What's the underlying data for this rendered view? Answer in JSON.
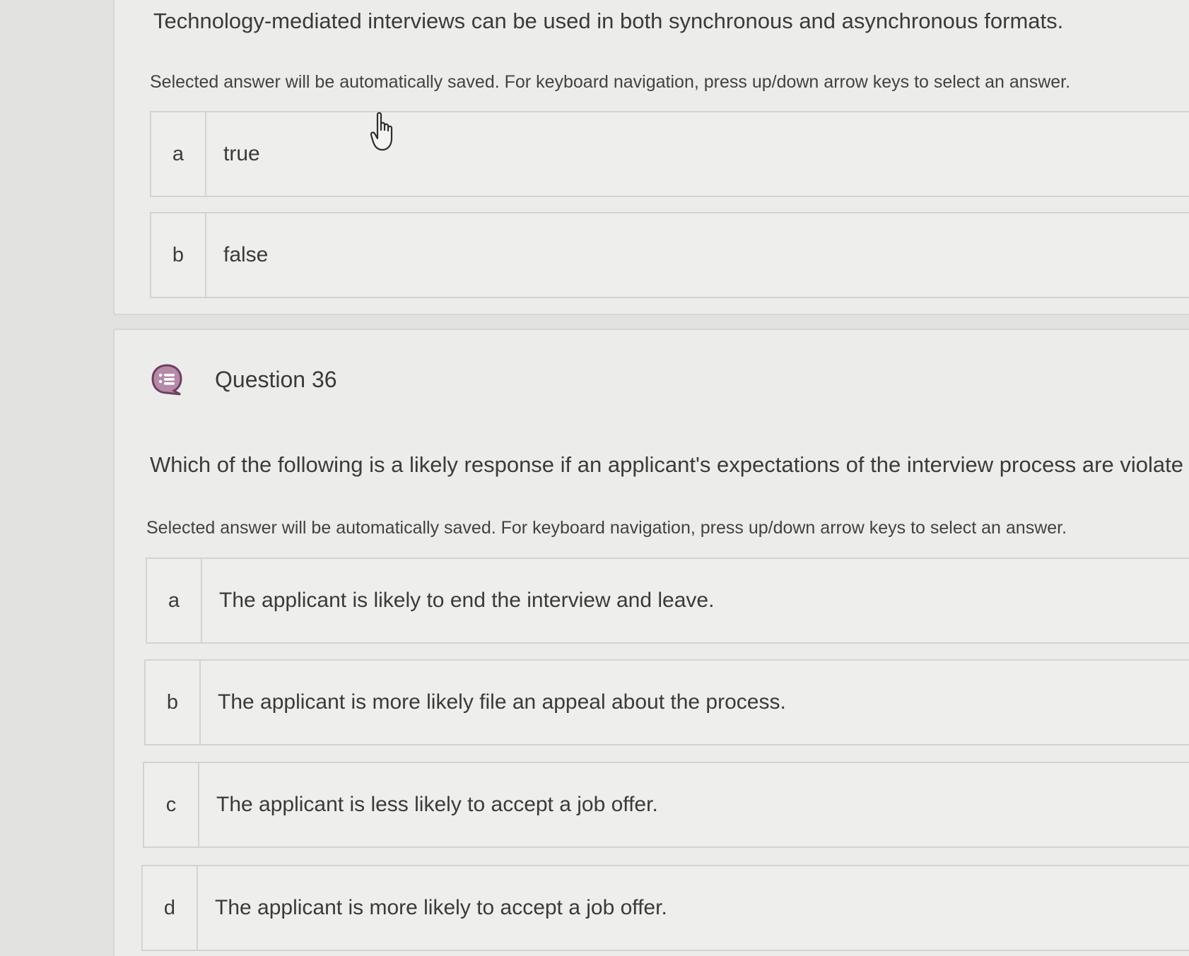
{
  "question_35": {
    "text": "Technology-mediated interviews can be used in both synchronous and asynchronous formats.",
    "hint": "Selected answer will be automatically saved. For keyboard navigation, press up/down arrow keys to select an answer.",
    "options": [
      {
        "letter": "a",
        "label": "true"
      },
      {
        "letter": "b",
        "label": "false"
      }
    ]
  },
  "question_36": {
    "title": "Question 36",
    "icon": "multiple-choice-icon",
    "text": "Which of the following is a likely response if an applicant's expectations of the interview process are violate",
    "hint": "Selected answer will be automatically saved. For keyboard navigation, press up/down arrow keys to select an answer.",
    "options": [
      {
        "letter": "a",
        "label": "The applicant is likely to end the interview and leave."
      },
      {
        "letter": "b",
        "label": "The applicant is more likely file an appeal about the process."
      },
      {
        "letter": "c",
        "label": "The applicant is less likely to accept a job offer."
      },
      {
        "letter": "d",
        "label": "The applicant is more likely to accept a job offer."
      }
    ]
  },
  "colors": {
    "icon_accent": "#7a4a6e",
    "background": "#e2e2e0",
    "card": "#ececea",
    "border": "#d3d3d0"
  }
}
